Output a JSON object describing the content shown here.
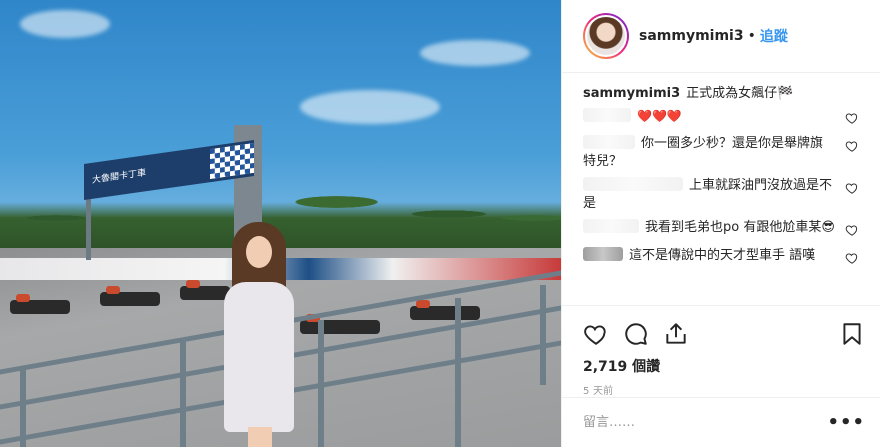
{
  "header": {
    "username": "sammymimi3",
    "separator": "•",
    "follow_label": "追蹤"
  },
  "caption": {
    "username": "sammymimi3",
    "text": "正式成為女飆仔🏁"
  },
  "comments": [
    {
      "text": "❤️❤️❤️"
    },
    {
      "text": "你一圈多少秒？還是你是舉牌旗特兒？"
    },
    {
      "text": "上車就踩油門沒放過是不是"
    },
    {
      "text": "我看到毛弟也po 有跟他尬車某😎"
    },
    {
      "text": "這不是傳說中的天才型車手 語嘆"
    }
  ],
  "stats": {
    "views": "2,719 個讚",
    "time_ago": "5 天前"
  },
  "add_comment": {
    "placeholder": "留言……",
    "more_label": "•••"
  },
  "photo": {
    "banner_text": "大魯閣卡丁車"
  }
}
